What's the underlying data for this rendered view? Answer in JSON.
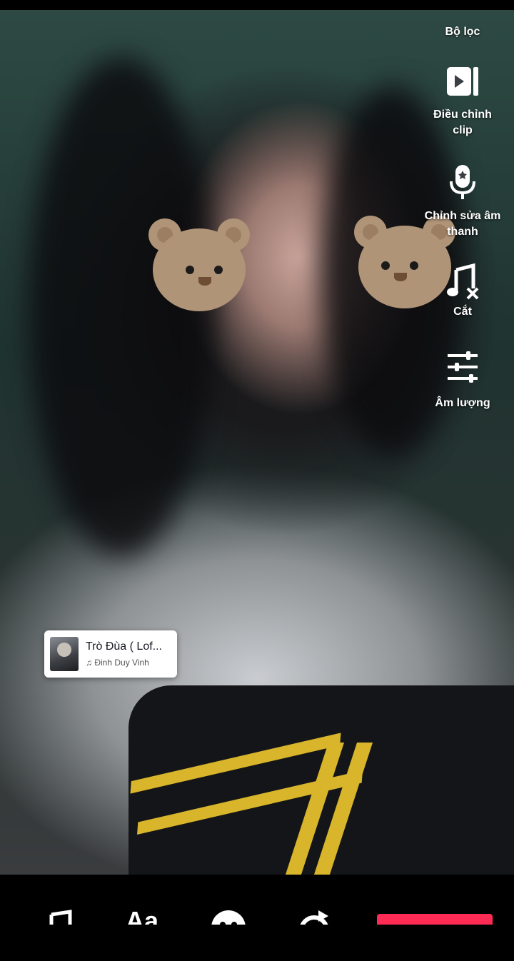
{
  "right_tools": [
    {
      "label": "Bộ lọc",
      "icon": "filter-icon"
    },
    {
      "label": "Điều chỉnh clip",
      "icon": "adjust-clip-icon"
    },
    {
      "label": "Chỉnh sửa âm thanh",
      "icon": "voice-effects-icon"
    },
    {
      "label": "Cắt",
      "icon": "trim-sound-icon"
    },
    {
      "label": "Âm lượng",
      "icon": "volume-sliders-icon"
    }
  ],
  "music": {
    "song": "Trò Đùa ( Lof...",
    "artist": "Đinh Duy Vinh",
    "note_icon": "music-note-icon"
  },
  "bottom_bar": {
    "icons": [
      "sounds-icon",
      "text-icon",
      "stickers-icon",
      "effects-icon"
    ],
    "text_label": "Aa",
    "accent": "#fe2c55"
  }
}
